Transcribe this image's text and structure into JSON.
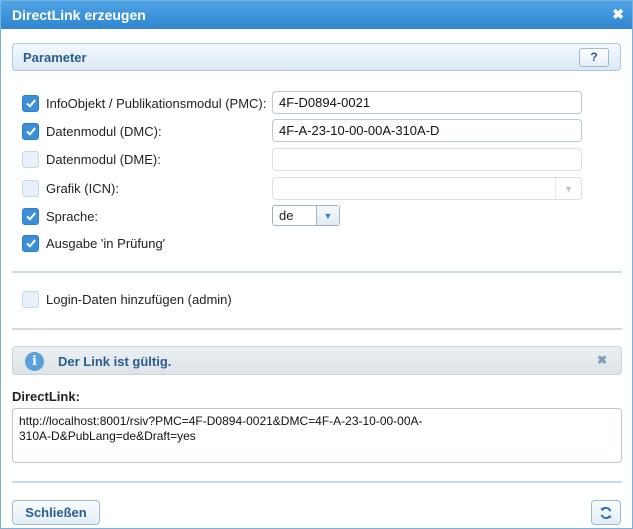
{
  "dialog": {
    "title": "DirectLink erzeugen",
    "close_glyph": "✖"
  },
  "parameter": {
    "label": "Parameter",
    "help_label": "?"
  },
  "options": [
    {
      "label": "InfoObjekt / Publikationsmodul (PMC):",
      "checked": true,
      "value": "4F-D0894-0021"
    },
    {
      "label": "Datenmodul (DMC):",
      "checked": true,
      "value": "4F-A-23-10-00-00A-310A-D"
    },
    {
      "label": "Datenmodul (DME):",
      "checked": false,
      "value": ""
    },
    {
      "label": "Grafik (ICN):",
      "checked": false,
      "value": ""
    },
    {
      "label": "Sprache:",
      "checked": true,
      "value": "de"
    },
    {
      "label": "Ausgabe 'in Prüfung'",
      "checked": true
    }
  ],
  "login": {
    "label": "Login-Daten hinzufügen (admin)",
    "checked": false
  },
  "info": {
    "icon_glyph": "i",
    "message": "Der Link ist gültig.",
    "close_glyph": "✖"
  },
  "directlink": {
    "label": "DirectLink:",
    "value": "http://localhost:8001/rsiv?PMC=4F-D0894-0021&DMC=4F-A-23-10-00-00A-\n310A-D&PubLang=de&Draft=yes"
  },
  "footer": {
    "close_label": "Schließen"
  },
  "colors": {
    "accent": "#3b8fd8",
    "title_bar": "#2f86cf",
    "heading_text": "#2a5d8f"
  }
}
